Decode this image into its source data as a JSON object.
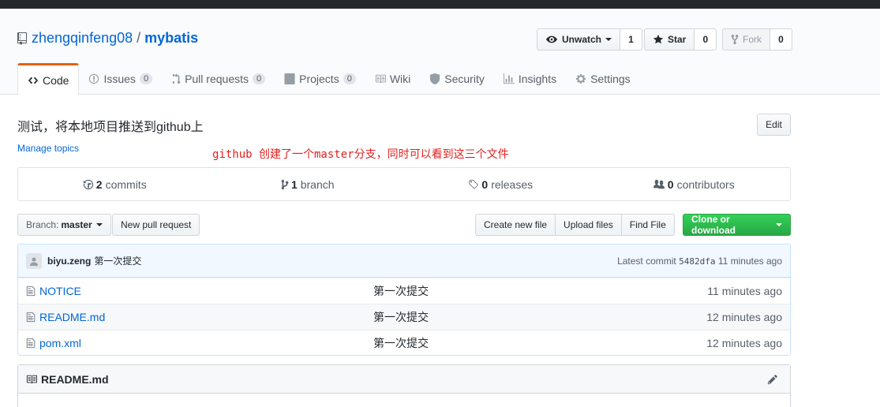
{
  "repo": {
    "owner": "zhengqinfeng08",
    "separator": "/",
    "name": "mybatis"
  },
  "social": {
    "watch_label": "Unwatch",
    "watch_count": "1",
    "star_label": "Star",
    "star_count": "0",
    "fork_label": "Fork",
    "fork_count": "0"
  },
  "tabs": [
    {
      "label": "Code",
      "icon": "code-icon"
    },
    {
      "label": "Issues",
      "count": "0",
      "icon": "issue-icon"
    },
    {
      "label": "Pull requests",
      "count": "0",
      "icon": "pull-request-icon"
    },
    {
      "label": "Projects",
      "count": "0",
      "icon": "project-icon"
    },
    {
      "label": "Wiki",
      "icon": "book-icon"
    },
    {
      "label": "Security",
      "icon": "shield-icon"
    },
    {
      "label": "Insights",
      "icon": "graph-icon"
    },
    {
      "label": "Settings",
      "icon": "gear-icon"
    }
  ],
  "description": "测试，将本地项目推送到github上",
  "manage_topics": "Manage topics",
  "edit_label": "Edit",
  "annotation": "github 创建了一个master分支，同时可以看到这三个文件",
  "summary": {
    "commits_num": "2",
    "commits_label": "commits",
    "branch_num": "1",
    "branch_label": "branch",
    "releases_num": "0",
    "releases_label": "releases",
    "contributors_num": "0",
    "contributors_label": "contributors"
  },
  "toolbar": {
    "branch_prefix": "Branch:",
    "branch_name": "master",
    "new_pr": "New pull request",
    "create_file": "Create new file",
    "upload_files": "Upload files",
    "find_file": "Find File",
    "clone": "Clone or download"
  },
  "latest_commit": {
    "author": "biyu.zeng",
    "message": "第一次提交",
    "prefix": "Latest commit",
    "sha": "5482dfa",
    "age": "11 minutes ago"
  },
  "files": [
    {
      "name": "NOTICE",
      "message": "第一次提交",
      "age": "11 minutes ago"
    },
    {
      "name": "README.md",
      "message": "第一次提交",
      "age": "12 minutes ago"
    },
    {
      "name": "pom.xml",
      "message": "第一次提交",
      "age": "12 minutes ago"
    }
  ],
  "readme_title": "README.md",
  "colors": {
    "link": "#0366d6",
    "accent_tab": "#e36209",
    "green": "#28a745",
    "annotation": "#e02020"
  }
}
